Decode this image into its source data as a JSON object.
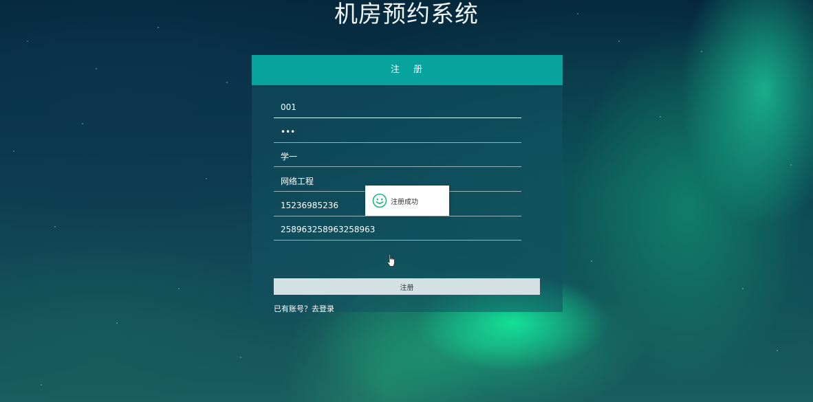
{
  "header": {
    "title": "机房预约系统"
  },
  "panel": {
    "title": "注 册"
  },
  "form": {
    "fields": [
      {
        "value": "001",
        "type": "text"
      },
      {
        "value": "123",
        "type": "password"
      },
      {
        "value": "学一",
        "type": "text"
      },
      {
        "value": "网络工程",
        "type": "text"
      },
      {
        "value": "15236985236",
        "type": "text"
      },
      {
        "value": "258963258963258963",
        "type": "text"
      }
    ],
    "submit_label": "注册",
    "login_link": "已有账号？去登录"
  },
  "toast": {
    "message": "注册成功",
    "icon": "smile-icon",
    "icon_color": "#15b87c"
  },
  "colors": {
    "header_bar": "#08a39d",
    "button_bg": "#d3e1e5"
  }
}
